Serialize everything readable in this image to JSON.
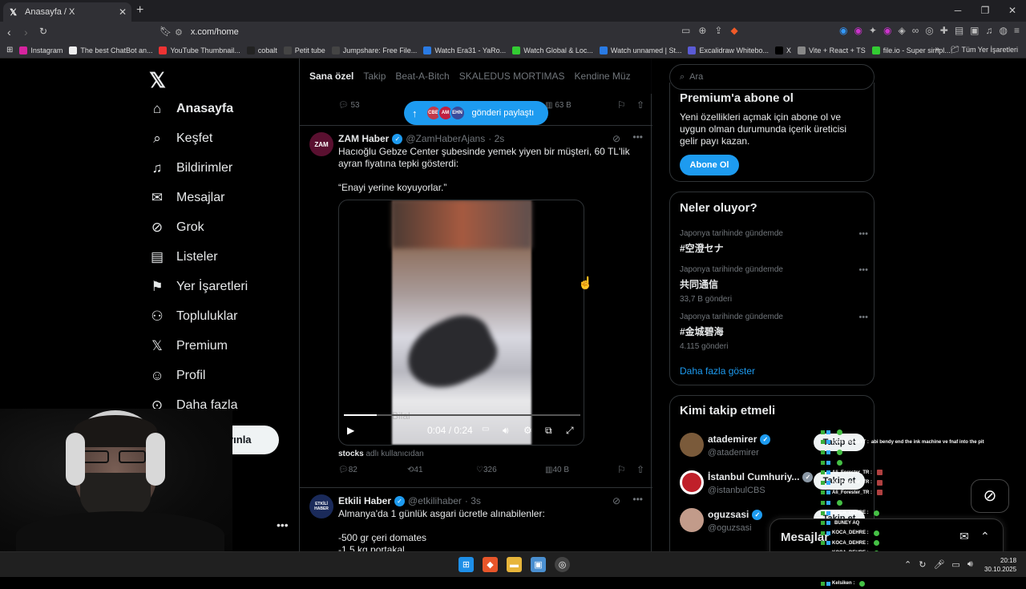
{
  "browser": {
    "tab_title": "Anasayfa / X",
    "url": "x.com/home",
    "bookmarks": [
      {
        "label": "Instagram",
        "color": "#d6249f"
      },
      {
        "label": "The best ChatBot an...",
        "color": "#eeeeee"
      },
      {
        "label": "YouTube Thumbnail...",
        "color": "#e33"
      },
      {
        "label": "cobalt",
        "color": "#222"
      },
      {
        "label": "Petit tube",
        "color": "#444"
      },
      {
        "label": "Jumpshare: Free File...",
        "color": "#444"
      },
      {
        "label": "Watch Era31 - YaRo...",
        "color": "#2a7be4"
      },
      {
        "label": "Watch Global & Loc...",
        "color": "#3c3"
      },
      {
        "label": "Watch unnamed | St...",
        "color": "#2a7be4"
      },
      {
        "label": "Excalidraw Whitebo...",
        "color": "#5b5bd6"
      },
      {
        "label": "X",
        "color": "#000"
      },
      {
        "label": "Vite + React + TS",
        "color": "#888"
      },
      {
        "label": "file.io - Super simpl...",
        "color": "#3c3"
      }
    ],
    "all_bookmarks": "Tüm Yer İşaretleri"
  },
  "nav": {
    "items": [
      {
        "label": "Anasayfa"
      },
      {
        "label": "Keşfet"
      },
      {
        "label": "Bildirimler"
      },
      {
        "label": "Mesajlar"
      },
      {
        "label": "Grok"
      },
      {
        "label": "Listeler"
      },
      {
        "label": "Yer İşaretleri"
      },
      {
        "label": "Topluluklar"
      },
      {
        "label": "Premium"
      },
      {
        "label": "Profil"
      },
      {
        "label": "Daha fazla"
      }
    ],
    "post_button": "Gönderi yayınla"
  },
  "feed": {
    "tabs": [
      "Sana özel",
      "Takip",
      "Beat-A-Bitch",
      "SKALEDUS MORTIMAS",
      "Kendine Müz"
    ],
    "new_posts_pill": "gönderi paylaştı",
    "pill_avatars": [
      "CBE",
      "AM",
      "EHN"
    ],
    "prev_post": {
      "replies": "53",
      "views": "63 B"
    },
    "tweet1": {
      "name": "ZAM Haber",
      "handle": "@ZamHaberAjans",
      "time": "· 2s",
      "avatar_text": "ZAM",
      "text": "Hacıoğlu Gebze Center şubesinde yemek yiyen bir müşteri, 60 TL'lik ayran fiyatına tepki gösterdi:\n\n“Enayi yerine koyuyorlar.”",
      "video_time": "0:04 / 0:24",
      "video_caption": "Bilal",
      "video_progress": 0.14,
      "attribution_user": "stocks",
      "attribution_rest": " adlı kullanıcıdan",
      "replies": "82",
      "reposts": "41",
      "likes": "326",
      "views": "40 B"
    },
    "tweet2": {
      "name": "Etkili Haber",
      "handle": "@etkilihaber",
      "time": "· 3s",
      "avatar_text": "ETKİLİ HABER",
      "text": "Almanya'da 1 günlük asgari ücretle alınabilenler:\n\n-500 gr çeri domates\n-1,5 kg portakal"
    }
  },
  "right": {
    "search_placeholder": "Ara",
    "premium": {
      "title": "Premium'a abone ol",
      "text": "Yeni özellikleri açmak için abone ol ve uygun olman durumunda içerik üreticisi gelir payı kazan.",
      "button": "Abone Ol"
    },
    "trends": {
      "title": "Neler oluyor?",
      "items": [
        {
          "context": "Japonya tarihinde gündemde",
          "topic": "#空澄セナ",
          "count": ""
        },
        {
          "context": "Japonya tarihinde gündemde",
          "topic": "共同通信",
          "count": "33,7 B gönderi"
        },
        {
          "context": "Japonya tarihinde gündemde",
          "topic": "#金城碧海",
          "count": "4.115 gönderi"
        }
      ],
      "show_more": "Daha fazla göster"
    },
    "who_to_follow": {
      "title": "Kimi takip etmeli",
      "items": [
        {
          "name": "atademirer",
          "handle": "@atademirer",
          "color": "#7a5a3a",
          "verify_color": "#1d9bf0"
        },
        {
          "name": "İstanbul Cumhuriy...",
          "handle": "@istanbulCBS",
          "color": "#c0202a",
          "verify_color": "#8b98a5"
        },
        {
          "name": "oguzsasi",
          "handle": "@oguzsasi",
          "color": "#c29b8a",
          "verify_color": "#1d9bf0"
        }
      ],
      "follow_label": "Takip et"
    },
    "messages_title": "Mesajlar"
  },
  "chat": [
    {
      "user": "",
      "msg": ""
    },
    {
      "user": "EnesTekbasYT :",
      "msg": "abi bendy end the ink machine ve fnaf into the pit"
    },
    {
      "user": "",
      "msg": ""
    },
    {
      "user": "",
      "msg": ""
    },
    {
      "user": "Ali_Forester_TR :",
      "msg": ""
    },
    {
      "user": "Ali_Forester_TR :",
      "msg": ""
    },
    {
      "user": "Ali_Forester_TR :",
      "msg": ""
    },
    {
      "user": "",
      "msg": ""
    },
    {
      "user": "KOCA_DEHRE :",
      "msg": ""
    },
    {
      "user": "",
      "msg": "BUNEY AQ"
    },
    {
      "user": "KOCA_DEHRE :",
      "msg": ""
    },
    {
      "user": "KOCA_DEHRE :",
      "msg": ""
    },
    {
      "user": "KOCA_DEHRE :",
      "msg": ""
    },
    {
      "user": "KOCA_DEHRE :",
      "msg": ""
    },
    {
      "user": "Kelsiken :",
      "msg": ""
    },
    {
      "user": "Kelsiken :",
      "msg": ""
    }
  ],
  "taskbar": {
    "time": "20:18",
    "date": "30.10.2025"
  }
}
